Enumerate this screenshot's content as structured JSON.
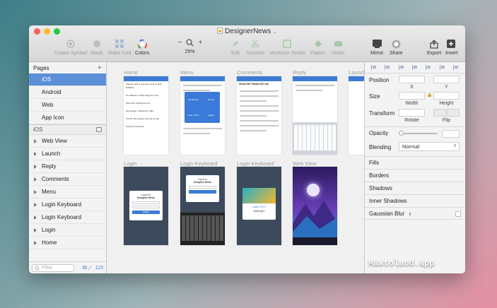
{
  "window": {
    "title": "DesignerNews"
  },
  "toolbar": {
    "create_symbol": "Create Symbol",
    "mask": "Mask",
    "make_grid": "Make Grid",
    "colors": "Colors",
    "zoom_minus": "−",
    "zoom_plus": "+",
    "zoom_level": "25%",
    "edit": "Edit",
    "scissors": "Scissors",
    "vectorize_stroke": "Vectorize Stroke",
    "flatten": "Flatten",
    "union": "Union",
    "mirror": "Mirror",
    "share": "Share",
    "export": "Export",
    "insert": "Insert"
  },
  "sidebar": {
    "pages_label": "Pages",
    "pages": [
      "iOS",
      "Android",
      "Web",
      "App Icon"
    ],
    "selected_page": "iOS",
    "layers_label": "iOS",
    "layers": [
      "Web View",
      "Launch",
      "Reply",
      "Comments",
      "Menu",
      "Login Keyboard",
      "Login Keyboard",
      "Login",
      "Home"
    ],
    "filter_placeholder": "Filter",
    "layer_count": "123"
  },
  "canvas": {
    "artboards": [
      "Home",
      "Menu",
      "Comments",
      "Reply",
      "Launch",
      "Login",
      "Login Keyboard",
      "Login Keyboard",
      "Web View"
    ],
    "home_items": [
      "Stephen Hall is a genius: How he Won Dribbble",
      "Tim Bahnsen: What happens next?",
      "Show DN: Panda iOS Lite",
      "Site Design: Spacemen 1099",
      "Top 50 'Site Design' pounds on Site",
      "Notify by Facebook"
    ],
    "menu_items": [
      "Top Stories",
      "Recent",
      "Learn iOS 9",
      "Logout"
    ],
    "comments_title": "Show DN: Panda iOS Lite",
    "login_title": "Log in to",
    "login_brand": "Designer News",
    "login_button": "Log in",
    "learn_label": "Learn iOS 9",
    "learn_author": "@MengTo"
  },
  "inspector": {
    "position": "Position",
    "x": "X",
    "y": "Y",
    "size": "Size",
    "width": "Width",
    "height": "Height",
    "transform": "Transform",
    "rotate": "Rotate",
    "flip": "Flip",
    "opacity": "Opacity",
    "blending": "Blending",
    "blending_value": "Normal",
    "fills": "Fills",
    "borders": "Borders",
    "shadows": "Shadows",
    "inner_shadows": "Inner Shadows",
    "gaussian_blur": "Gaussian Blur"
  },
  "watermark": "Mawtolaod.app",
  "colors": {
    "accent": "#5b8fd8",
    "brand_blue": "#3b7bd6",
    "purple": "#6a3fb8"
  }
}
